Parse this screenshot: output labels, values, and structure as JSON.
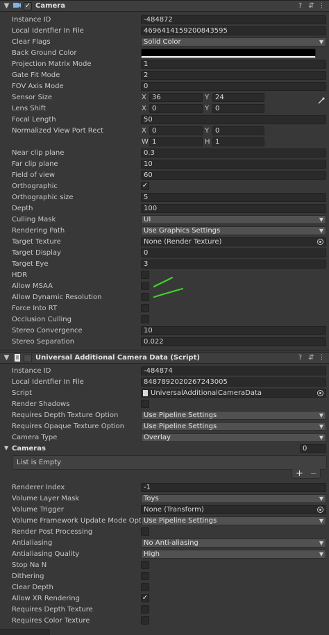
{
  "camera": {
    "title": "Camera",
    "instance_id_label": "Instance ID",
    "instance_id": "-484872",
    "local_id_label": "Local Identfier In File",
    "local_id": "4696414159200843595",
    "clear_flags_label": "Clear Flags",
    "clear_flags": "Solid Color",
    "bg_color_label": "Back Ground Color",
    "proj_matrix_label": "Projection Matrix Mode",
    "proj_matrix": "1",
    "gate_fit_label": "Gate Fit Mode",
    "gate_fit": "2",
    "fov_axis_label": "FOV Axis Mode",
    "fov_axis": "0",
    "sensor_size_label": "Sensor Size",
    "sensor_x": "36",
    "sensor_y": "24",
    "lens_shift_label": "Lens Shift",
    "lens_x": "0",
    "lens_y": "0",
    "focal_label": "Focal Length",
    "focal": "50",
    "viewport_label": "Normalized View Port Rect",
    "vp_x": "0",
    "vp_y": "0",
    "vp_w": "1",
    "vp_h": "1",
    "near_label": "Near clip plane",
    "near": "0.3",
    "far_label": "Far clip plane",
    "far": "10",
    "fov_label": "Field of view",
    "fov": "60",
    "ortho_label": "Orthographic",
    "ortho_size_label": "Orthographic size",
    "ortho_size": "5",
    "depth_label": "Depth",
    "depth": "100",
    "culling_label": "Culling Mask",
    "culling": "UI",
    "render_path_label": "Rendering Path",
    "render_path": "Use Graphics Settings",
    "target_tex_label": "Target Texture",
    "target_tex": "None (Render Texture)",
    "target_display_label": "Target Display",
    "target_display": "0",
    "target_eye_label": "Target Eye",
    "target_eye": "3",
    "hdr_label": "HDR",
    "msaa_label": "Allow MSAA",
    "dyn_res_label": "Allow Dynamic Resolution",
    "force_rt_label": "Force Into RT",
    "occlusion_label": "Occlusion Culling",
    "stereo_conv_label": "Stereo Convergence",
    "stereo_conv": "10",
    "stereo_sep_label": "Stereo Separation",
    "stereo_sep": "0.022"
  },
  "urp": {
    "title": "Universal Additional Camera Data (Script)",
    "instance_id_label": "Instance ID",
    "instance_id": "-484874",
    "local_id_label": "Local Identfier In File",
    "local_id": "8487892020267243005",
    "script_label": "Script",
    "script": "UniversalAdditionalCameraData",
    "render_shadows_label": "Render Shadows",
    "req_depth_opt_label": "Requires Depth Texture Option",
    "req_depth_opt": "Use Pipeline Settings",
    "req_opaque_opt_label": "Requires Opaque Texture Option",
    "req_opaque_opt": "Use Pipeline Settings",
    "camera_type_label": "Camera Type",
    "camera_type": "Overlay",
    "cameras_label": "Cameras",
    "cameras_count": "0",
    "list_empty": "List is Empty",
    "add": "+",
    "remove": "−",
    "renderer_index_label": "Renderer Index",
    "renderer_index": "-1",
    "volume_mask_label": "Volume Layer Mask",
    "volume_mask": "Toys",
    "volume_trigger_label": "Volume Trigger",
    "volume_trigger": "None (Transform)",
    "volume_update_label": "Volume Framework Update Mode Option",
    "volume_update": "Use Pipeline Settings",
    "post_label": "Render Post Processing",
    "aa_label": "Antialiasing",
    "aa": "No Anti-aliasing",
    "aa_quality_label": "Antialiasing Quality",
    "aa_quality": "High",
    "stop_nan_label": "Stop Na N",
    "dithering_label": "Dithering",
    "clear_depth_label": "Clear Depth",
    "xr_label": "Allow XR Rendering",
    "req_depth_tex_label": "Requires Depth Texture",
    "req_color_tex_label": "Requires Color Texture"
  },
  "icons": {
    "check": "✓",
    "arrow": "▼",
    "help": "?",
    "preset": "⇵",
    "menu": "⋮"
  },
  "colors": {
    "annotation": "#3ed12a",
    "field_bg": "#2a2a2a",
    "panel_bg": "#383838"
  }
}
